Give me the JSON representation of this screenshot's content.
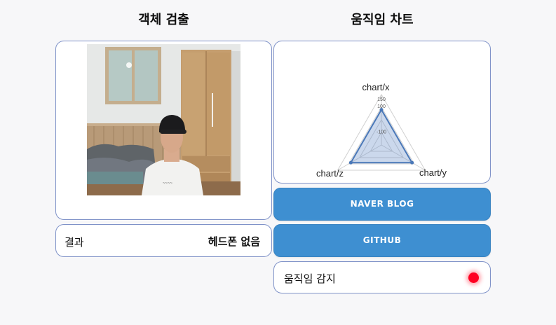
{
  "left_column": {
    "title": "객체 검출",
    "camera_alt": "camera feed",
    "result_label": "결과",
    "result_value": "헤드폰 없음"
  },
  "right_column": {
    "title": "움직임 차트",
    "naver_label": "NAVER BLOG",
    "github_label": "GITHUB",
    "motion_label": "움직임 감지",
    "motion_color": "#ff0022"
  },
  "colors": {
    "button": "#3e8fd1",
    "panel_border": "#7f92c8",
    "radar_fill": "#6a90c8"
  },
  "chart_data": {
    "type": "radar",
    "axes": [
      "chart/x",
      "chart/y",
      "chart/z"
    ],
    "ticks": [
      "150",
      "100",
      "-100"
    ],
    "series": [
      {
        "values": [
          60,
          60,
          60
        ]
      }
    ],
    "range": [
      -150,
      150
    ]
  }
}
